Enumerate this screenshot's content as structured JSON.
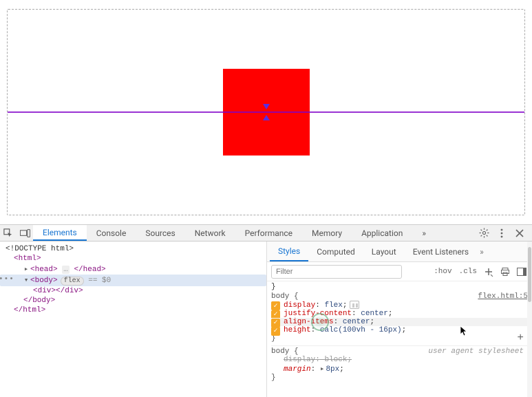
{
  "tabs": {
    "main": [
      "Elements",
      "Console",
      "Sources",
      "Network",
      "Performance",
      "Memory",
      "Application"
    ],
    "active": 0
  },
  "subtabs": {
    "items": [
      "Styles",
      "Computed",
      "Layout",
      "Event Listeners"
    ],
    "active": 0
  },
  "filter": {
    "placeholder": "Filter",
    "hov": ":hov",
    "cls": ".cls"
  },
  "tree": {
    "doctype": "<!DOCTYPE html>",
    "html_open": "<html>",
    "head_open": "<head>",
    "head_close": "</head>",
    "body_open": "<body>",
    "body_badge": "flex",
    "body_eq": "== $0",
    "div_open": "<div>",
    "div_close": "</div>",
    "body_close": "</body>",
    "html_close": "</html>"
  },
  "styles": {
    "close_brace_prev": "}",
    "rule1": {
      "selector": "body",
      "src": "flex.html:5",
      "props": [
        {
          "name": "display",
          "value": "flex",
          "has_flex_swatch": true
        },
        {
          "name": "justify-content",
          "value": "center"
        },
        {
          "name": "align-items",
          "value": "center"
        },
        {
          "name": "height",
          "value": "calc(100vh - 16px)"
        }
      ]
    },
    "rule2": {
      "selector": "body",
      "ua": "user agent stylesheet",
      "display_line": {
        "name": "display",
        "value": "block"
      },
      "margin_line": {
        "name": "margin",
        "value": "8px"
      }
    }
  },
  "punct": {
    "open": "{",
    "close": "}",
    "semi": ";",
    "colon": ":",
    "tri": "▸",
    "tridown": "▾",
    "dots": "…",
    "chev": "»",
    "plus": "+"
  }
}
